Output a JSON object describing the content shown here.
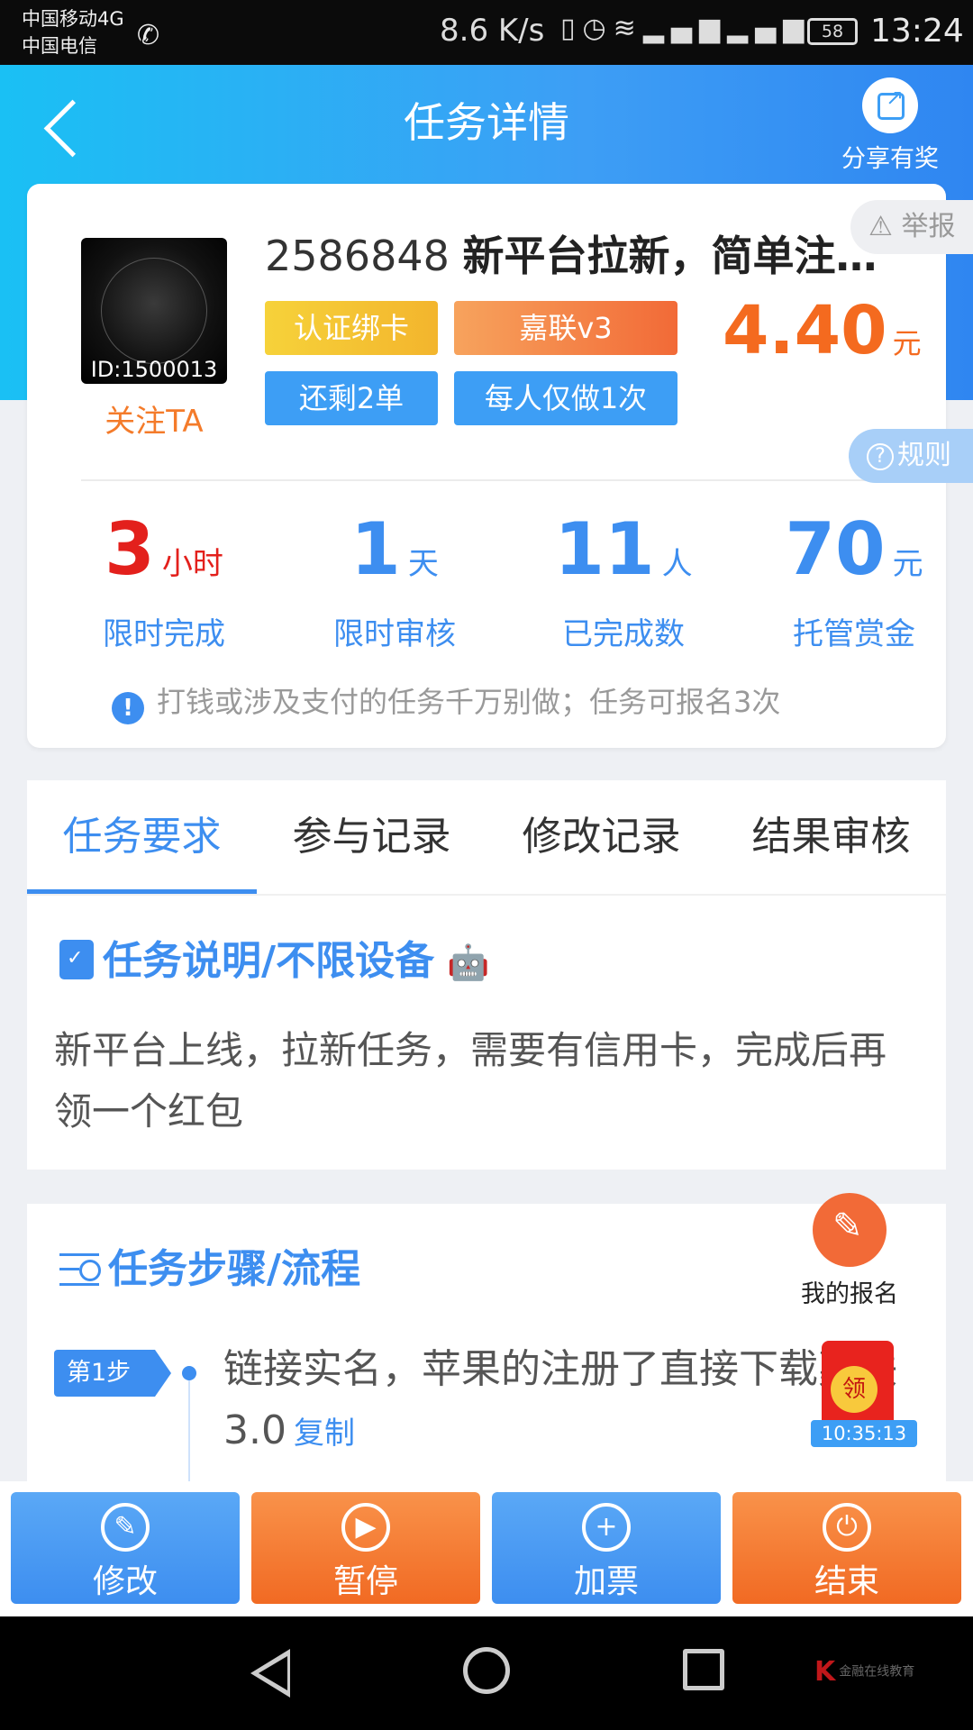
{
  "status_bar": {
    "carrier_1": "中国移动4G",
    "carrier_2": "中国电信",
    "net_speed": "8.6 K/s",
    "battery": "58",
    "time": "13:24"
  },
  "header": {
    "title": "任务详情",
    "share_label": "分享有奖"
  },
  "task": {
    "avatar_id": "ID:1500013",
    "follow_label": "关注TA",
    "number": "2586848",
    "title": "新平台拉新，简单注…",
    "tags": [
      "认证绑卡",
      "嘉联v3",
      "还剩2单",
      "每人仅做1次"
    ],
    "price": "4.40",
    "price_unit": "元",
    "report_label": "举报",
    "rule_label": "规则"
  },
  "stats": [
    {
      "value": "3",
      "unit": "小时",
      "label": "限时完成"
    },
    {
      "value": "1",
      "unit": "天",
      "label": "限时审核"
    },
    {
      "value": "11",
      "unit": "人",
      "label": "已完成数"
    },
    {
      "value": "70",
      "unit": "元",
      "label": "托管赏金"
    }
  ],
  "warning_text": "打钱或涉及支付的任务千万别做；任务可报名3次",
  "tabs": [
    "任务要求",
    "参与记录",
    "修改记录",
    "结果审核"
  ],
  "requirement": {
    "title": "任务说明/不限设备",
    "text": "新平台上线，拉新任务，需要有信用卡，完成后再领一个红包"
  },
  "steps": {
    "title": "任务步骤/流程",
    "items": [
      {
        "badge": "第1步",
        "text": "链接实名，苹果的注册了直接下载嘉联3.0",
        "copy_label": "复制"
      }
    ]
  },
  "my_signup_label": "我的报名",
  "redpacket": {
    "seal": "领",
    "timer": "10:35:13"
  },
  "actions": [
    {
      "label": "修改",
      "icon": "edit-icon"
    },
    {
      "label": "暂停",
      "icon": "pause-icon"
    },
    {
      "label": "加票",
      "icon": "plus-icon"
    },
    {
      "label": "结束",
      "icon": "power-icon"
    }
  ],
  "watermark": "金融在线教育",
  "colors": {
    "primary": "#3d8ef0",
    "accent_orange": "#f16a23",
    "price": "#f46a1f",
    "red": "#e3201c"
  }
}
